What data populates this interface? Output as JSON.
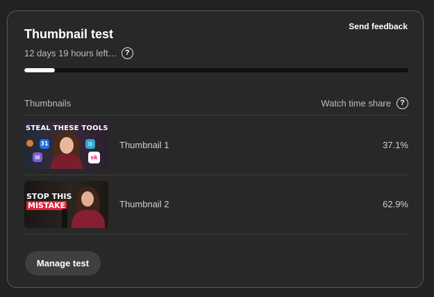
{
  "card": {
    "title": "Thumbnail test",
    "send_feedback": "Send feedback",
    "time_left": "12 days 19 hours left…",
    "help_glyph": "?",
    "progress_fraction": 0.08
  },
  "table": {
    "col_thumbnails": "Thumbnails",
    "col_share": "Watch time share",
    "rows": [
      {
        "label": "Thumbnail 1",
        "share": "37.1%",
        "image_text": "STEAL THESE TOOLS",
        "icons": [
          "calendar-app-icon",
          "document-app-icon",
          "analytics-app-icon",
          "sk-app-icon",
          "orange-app-icon"
        ],
        "icon_glyphs": [
          "31",
          "▤",
          "◎",
          "sk",
          ""
        ]
      },
      {
        "label": "Thumbnail 2",
        "share": "62.9%",
        "image_text_line1": "STOP THIS",
        "image_text_line2": "MISTAKE"
      }
    ]
  },
  "actions": {
    "manage_test": "Manage test"
  },
  "colors": {
    "background": "#222222",
    "card": "#282828",
    "progress_fill": "#ffffff",
    "mistake_red": "#e1233a"
  }
}
